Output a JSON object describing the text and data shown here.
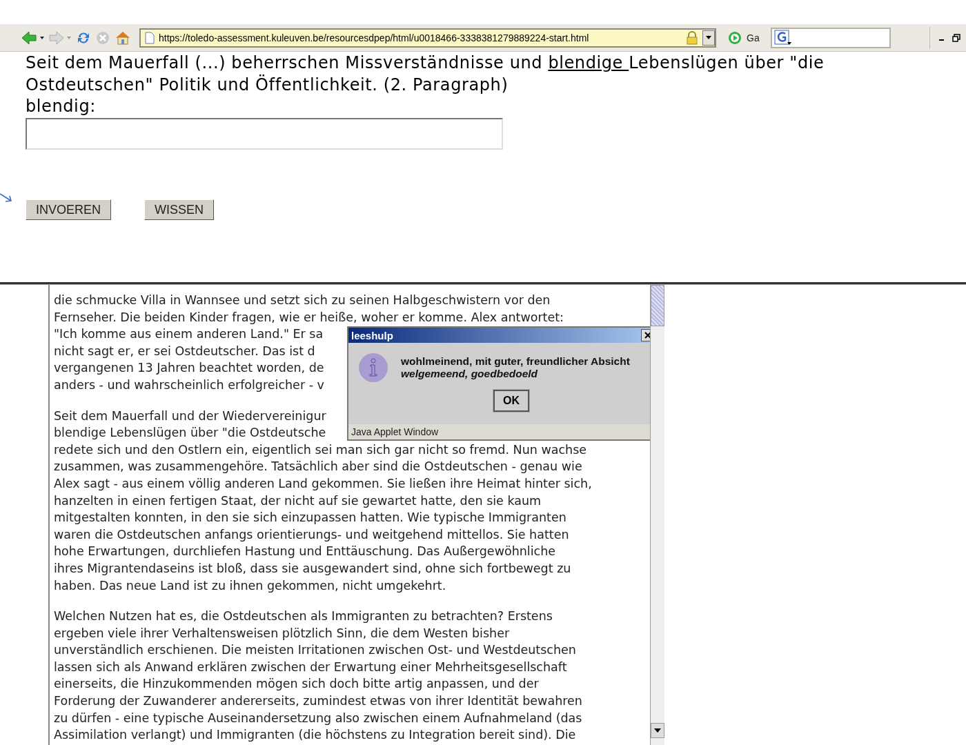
{
  "browser": {
    "address": "https://toledo-assessment.kuleuven.be/resourcesdpep/html/u0018466-3338381279889224-start.html",
    "go_label": "Ga"
  },
  "question": {
    "before": "Seit dem Mauerfall (...) beherrschen Missverständnisse und ",
    "underlined": "blendige ",
    "after": "Lebenslügen über \"die Ostdeutschen\" Politik und Öffentlichkeit. (2. Paragraph)",
    "prompt": "blendig:"
  },
  "buttons": [
    "INVOEREN",
    "WISSEN"
  ],
  "article": {
    "paragraphs": [
      [
        "die schmucke Villa in Wannsee und setzt sich zu seinen Halbgeschwistern vor den",
        "Fernseher. Die beiden Kinder fragen, wie er heiße, woher er komme. Alex antwortet:",
        "\"Ich komme aus einem anderen Land.\" Er sa",
        "nicht sagt er, er sei Ostdeutscher. Das ist d",
        "vergangenen 13 Jahren beachtet worden, de",
        "anders - und wahrscheinlich erfolgreicher - v"
      ],
      [
        "Seit dem Mauerfall und der Wiedervereinigur",
        "blendige Lebenslügen über \"die Ostdeutsche",
        "redete sich und den Ostlern ein, eigentlich sei man sich gar nicht so fremd. Nun wachse",
        "zusammen, was zusammengehöre. Tatsächlich aber sind die Ostdeutschen - genau wie",
        "Alex sagt - aus einem völlig anderen Land gekommen. Sie ließen ihre Heimat hinter sich,",
        "hanzelten in einen fertigen Staat, der nicht auf sie gewartet hatte, den sie kaum",
        "mitgestalten konnten, in den sie sich einzupassen hatten. Wie typische Immigranten",
        "waren die Ostdeutschen anfangs orientierungs- und weitgehend mittellos. Sie hatten",
        "hohe Erwartungen, durchliefen Hastung und Enttäuschung. Das Außergewöhnliche",
        "ihres Migrantendaseins ist bloß, dass sie ausgewandert sind, ohne sich fortbewegt zu",
        "haben. Das neue Land ist zu ihnen gekommen, nicht umgekehrt."
      ],
      [
        "Welchen Nutzen hat es, die Ostdeutschen als Immigranten zu betrachten? Erstens",
        "ergeben viele ihrer Verhaltensweisen plötzlich Sinn, die dem Westen bisher",
        "unverständlich erschienen. Die meisten Irritationen zwischen Ost- und Westdeutschen",
        "lassen sich als Anwand erklären zwischen der Erwartung einer Mehrheitsgesellschaft",
        "einerseits, die Hinzukommenden mögen sich doch bitte artig anpassen, und der",
        "Forderung der Zuwanderer andererseits, zumindest etwas von ihrer Identität bewahren",
        "zu dürfen - eine typische Auseinandersetzung also zwischen einem Aufnahmeland (das",
        "Assimilation verlangt) und Immigranten (die höchstens zu Integration bereit sind). Die"
      ]
    ]
  },
  "dialog": {
    "title": "leeshulp",
    "definition": "wohlmeinend, mit guter, freundlicher Absicht",
    "translation": "welgemeend, goedbedoeld",
    "button": "OK",
    "footer": "Java Applet Window"
  }
}
